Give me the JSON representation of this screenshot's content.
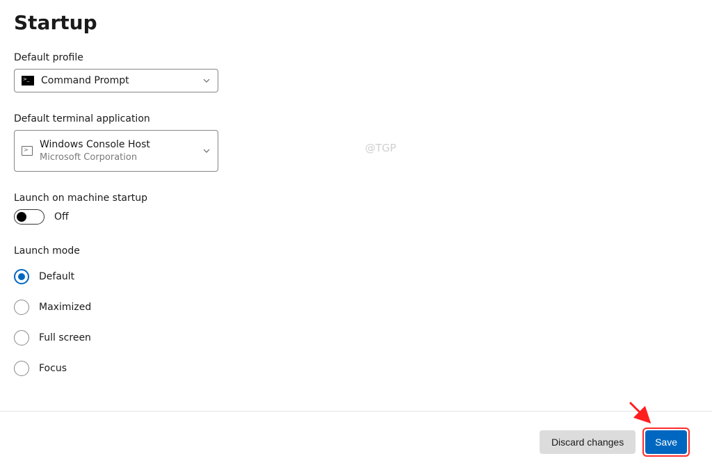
{
  "page": {
    "title": "Startup",
    "watermark": "@TGP"
  },
  "defaultProfile": {
    "label": "Default profile",
    "value": "Command Prompt"
  },
  "defaultTerminalApp": {
    "label": "Default terminal application",
    "value": "Windows Console Host",
    "publisher": "Microsoft Corporation"
  },
  "launchOnStartup": {
    "label": "Launch on machine startup",
    "state": "Off"
  },
  "launchMode": {
    "label": "Launch mode",
    "options": [
      "Default",
      "Maximized",
      "Full screen",
      "Focus"
    ],
    "selected": "Default"
  },
  "footer": {
    "discard": "Discard changes",
    "save": "Save"
  }
}
